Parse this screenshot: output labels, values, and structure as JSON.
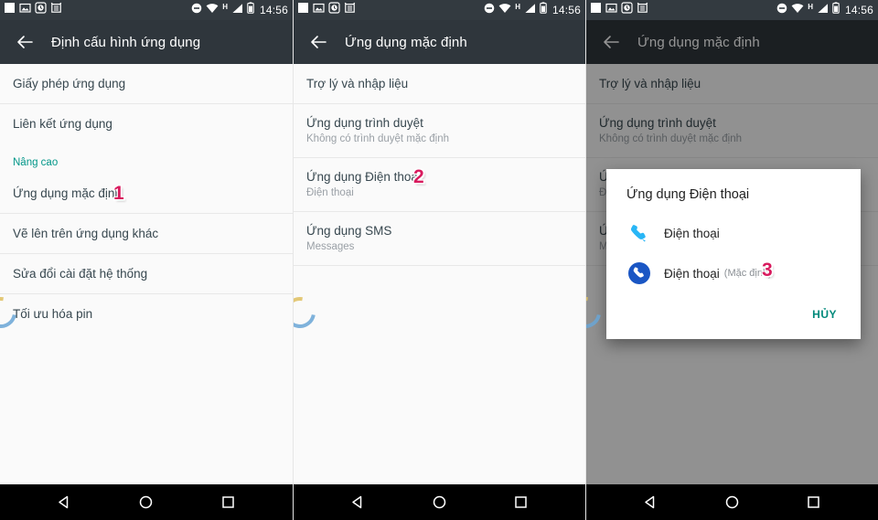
{
  "status_bar": {
    "time": "14:56",
    "network_type": "H",
    "icons_left": [
      "blank-notification-icon",
      "screenshot-icon",
      "clock-icon",
      "alarm-icon"
    ],
    "icons_right": [
      "do-not-disturb-icon",
      "wifi-icon",
      "signal-icon",
      "battery-icon"
    ]
  },
  "nav_bar": {
    "back": "back-triangle-icon",
    "home": "home-circle-icon",
    "recents": "recents-square-icon"
  },
  "panels": [
    {
      "id": "panel-1",
      "appbar": {
        "title": "Định cấu hình ứng dụng",
        "back_icon": "arrow-back-icon"
      },
      "rows": [
        {
          "primary": "Giấy phép ứng dụng",
          "secondary": ""
        },
        {
          "primary": "Liên kết ứng dụng",
          "secondary": ""
        }
      ],
      "section_header": "Nâng cao",
      "rows_after": [
        {
          "primary": "Ứng dụng mặc định",
          "secondary": "",
          "badge": "1"
        },
        {
          "primary": "Vẽ lên trên ứng dụng khác",
          "secondary": ""
        },
        {
          "primary": "Sửa đổi cài đặt hệ thống",
          "secondary": ""
        },
        {
          "primary": "Tối ưu hóa pin",
          "secondary": ""
        }
      ]
    },
    {
      "id": "panel-2",
      "appbar": {
        "title": "Ứng dụng mặc định",
        "back_icon": "arrow-back-icon"
      },
      "rows": [
        {
          "primary": "Trợ lý và nhập liệu",
          "secondary": ""
        },
        {
          "primary": "Ứng dụng trình duyệt",
          "secondary": "Không có trình duyệt mặc định"
        },
        {
          "primary": "Ứng dụng Điện thoại",
          "secondary": "Điện thoại",
          "badge": "2"
        },
        {
          "primary": "Ứng dụng SMS",
          "secondary": "Messages"
        }
      ]
    },
    {
      "id": "panel-3",
      "appbar": {
        "title": "Ứng dụng mặc định",
        "back_icon": "arrow-back-icon"
      },
      "rows": [
        {
          "primary": "Trợ lý và nhập liệu",
          "secondary": ""
        },
        {
          "primary": "Ứng dụng trình duyệt",
          "secondary": "Không có trình duyệt mặc định"
        },
        {
          "primary": "Ứng dụng Điện thoại",
          "secondary": "Điện thoại"
        },
        {
          "primary": "Ứng dụng SMS",
          "secondary": "Messages"
        }
      ],
      "dialog": {
        "title": "Ứng dụng Điện thoại",
        "options": [
          {
            "label": "Điện thoại",
            "note": "",
            "icon": "phone-handset-icon",
            "badge": ""
          },
          {
            "label": "Điện thoại",
            "note": "(Mặc định)",
            "icon": "phone-circle-icon",
            "badge": "3"
          }
        ],
        "cancel_label": "HỦY"
      }
    }
  ],
  "colors": {
    "appbar": "#2f363c",
    "statusbar": "#333a40",
    "accent_teal": "#009688",
    "badge_pink": "#d81b5e",
    "phone_light_blue": "#29b6f6",
    "phone_dark_blue": "#1a56c4",
    "list_bg": "#fafafa",
    "primary_text": "#37474f",
    "secondary_text": "#9aa0a6"
  }
}
